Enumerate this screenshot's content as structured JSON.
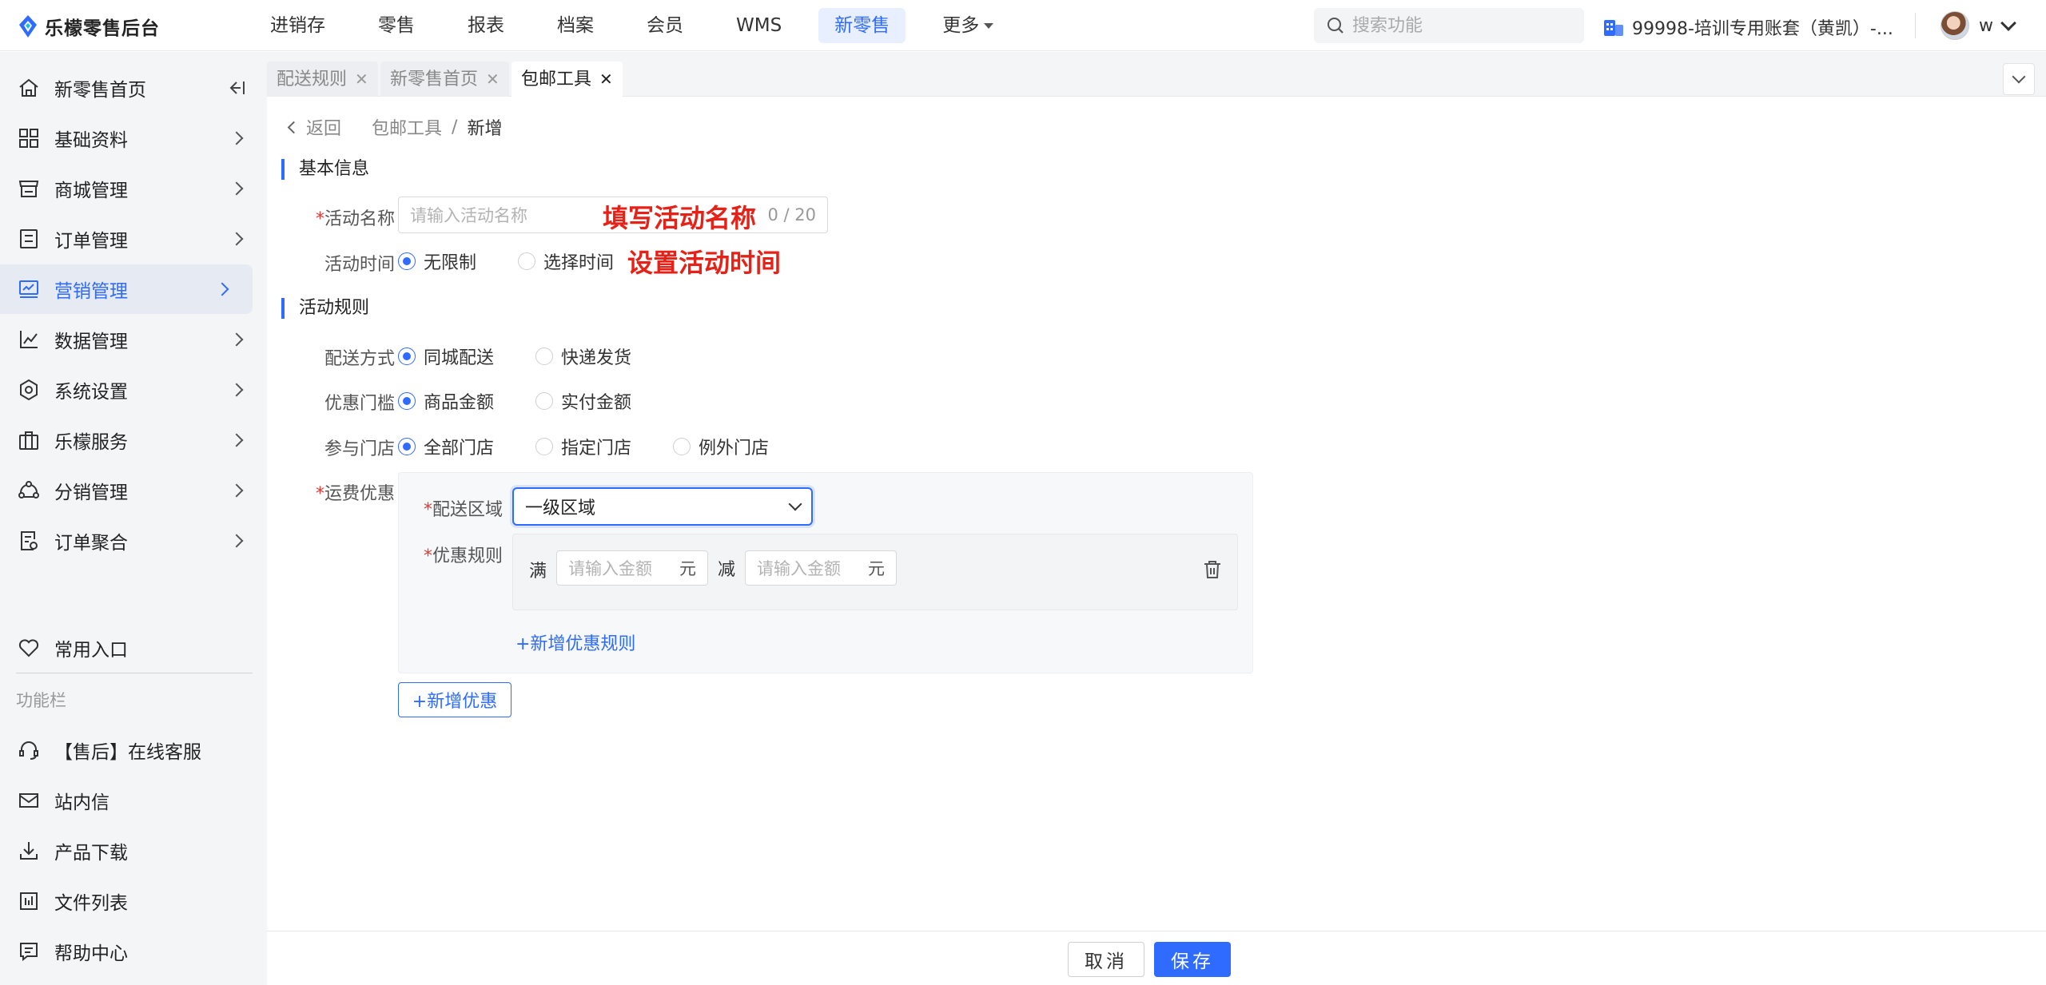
{
  "app": {
    "title": "乐檬零售后台"
  },
  "topnav": {
    "items": [
      "进销存",
      "零售",
      "报表",
      "档案",
      "会员",
      "WMS",
      "新零售",
      "更多"
    ],
    "active_index": 6
  },
  "search": {
    "placeholder": "搜索功能"
  },
  "account": {
    "name": "99998-培训专用账套（黄凯）-..."
  },
  "user": {
    "name": "w"
  },
  "sidebar": {
    "items": [
      {
        "label": "新零售首页",
        "icon": "home-icon"
      },
      {
        "label": "基础资料",
        "icon": "grid-icon"
      },
      {
        "label": "商城管理",
        "icon": "store-icon"
      },
      {
        "label": "订单管理",
        "icon": "order-icon"
      },
      {
        "label": "营销管理",
        "icon": "marketing-icon",
        "active": true
      },
      {
        "label": "数据管理",
        "icon": "chart-icon"
      },
      {
        "label": "系统设置",
        "icon": "settings-icon"
      },
      {
        "label": "乐檬服务",
        "icon": "briefcase-icon"
      },
      {
        "label": "分销管理",
        "icon": "distribution-icon"
      },
      {
        "label": "订单聚合",
        "icon": "aggregate-icon"
      }
    ],
    "common_entry": "常用入口",
    "section_label": "功能栏",
    "tools": [
      {
        "label": "【售后】在线客服",
        "icon": "headset-icon"
      },
      {
        "label": "站内信",
        "icon": "mail-icon"
      },
      {
        "label": "产品下载",
        "icon": "download-icon"
      },
      {
        "label": "文件列表",
        "icon": "file-list-icon"
      },
      {
        "label": "帮助中心",
        "icon": "help-icon"
      }
    ]
  },
  "tabs": [
    {
      "label": "配送规则"
    },
    {
      "label": "新零售首页"
    },
    {
      "label": "包邮工具",
      "active": true
    }
  ],
  "breadcrumb": {
    "back": "返回",
    "parent": "包邮工具",
    "current": "新增"
  },
  "basic": {
    "title": "基本信息",
    "name_label": "活动名称",
    "name_placeholder": "请输入活动名称",
    "name_count": "0 / 20",
    "name_annotation": "填写活动名称",
    "time_label": "活动时间",
    "time_options": [
      "无限制",
      "选择时间"
    ],
    "time_annotation": "设置活动时间"
  },
  "rules": {
    "title": "活动规则",
    "delivery_label": "配送方式",
    "delivery_options": [
      "同城配送",
      "快递发货"
    ],
    "threshold_label": "优惠门槛",
    "threshold_options": [
      "商品金额",
      "实付金额"
    ],
    "store_label": "参与门店",
    "store_options": [
      "全部门店",
      "指定门店",
      "例外门店"
    ],
    "fee_label": "运费优惠",
    "area_label": "配送区域",
    "area_value": "一级区域",
    "rule_label": "优惠规则",
    "full": "满",
    "minus": "减",
    "amount_placeholder": "请输入金额",
    "unit": "元",
    "add_rule": "+新增优惠规则",
    "add_discount": "+新增优惠"
  },
  "footer": {
    "cancel": "取消",
    "save": "保存"
  },
  "colors": {
    "accent": "#2f6bff",
    "annotation": "#e62117"
  }
}
